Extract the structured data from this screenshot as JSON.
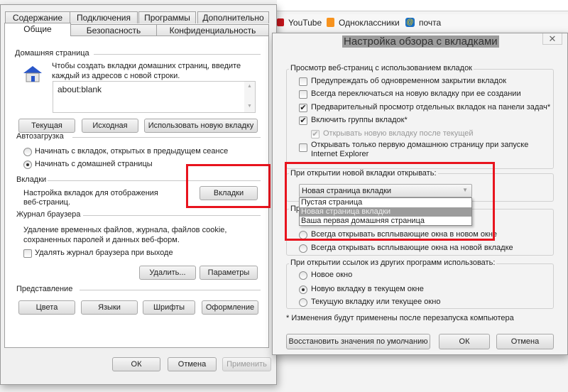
{
  "browser": {
    "favorites": [
      {
        "label": "YouTube",
        "icon": "youtube-icon",
        "color": "#c4161c"
      },
      {
        "label": "Одноклассники",
        "icon": "odnoklassniki-icon",
        "color": "#f7931e"
      },
      {
        "label": "почта",
        "icon": "mail-icon",
        "color": "#1a6fc4"
      }
    ]
  },
  "options": {
    "tabs_row1": [
      "Содержание",
      "Подключения",
      "Программы",
      "Дополнительно"
    ],
    "tabs_row2": [
      "Общие",
      "Безопасность",
      "Конфиденциальность"
    ],
    "active_tab": "Общие",
    "home": {
      "title": "Домашняя страница",
      "desc1": "Чтобы создать вкладки домашних страниц, введите",
      "desc2": "каждый из адресов с новой строки.",
      "value": "about:blank",
      "buttons": [
        "Текущая",
        "Исходная",
        "Использовать новую вкладку"
      ]
    },
    "startup": {
      "title": "Автозагрузка",
      "options": [
        "Начинать с вкладок, открытых в предыдущем сеансе",
        "Начинать с домашней страницы"
      ],
      "selected": 1
    },
    "tabs": {
      "title": "Вкладки",
      "desc1": "Настройка вкладок для отображения",
      "desc2": "веб-страниц.",
      "button": "Вкладки"
    },
    "history": {
      "title": "Журнал браузера",
      "desc1": "Удаление временных файлов, журнала, файлов cookie,",
      "desc2": "сохраненных паролей и данных веб-форм.",
      "checkbox": "Удалять журнал браузера при выходе",
      "checked": false,
      "buttons": [
        "Удалить...",
        "Параметры"
      ]
    },
    "appearance": {
      "title": "Представление",
      "buttons": [
        "Цвета",
        "Языки",
        "Шрифты",
        "Оформление"
      ]
    },
    "footer": {
      "ok": "ОК",
      "cancel": "Отмена",
      "apply": "Применить"
    }
  },
  "tabsettings": {
    "title": "Настройка обзора с вкладками",
    "browsing": {
      "title": "Просмотр веб-страниц с использованием вкладок",
      "items": [
        {
          "label": "Предупреждать об одновременном закрытии вкладок",
          "checked": false
        },
        {
          "label": "Всегда переключаться на новую вкладку при ее создании",
          "checked": false
        },
        {
          "label": "Предварительный просмотр отдельных вкладок на панели задач*",
          "checked": true
        },
        {
          "label": "Включить группы вкладок*",
          "checked": true
        },
        {
          "label": "Открывать новую вкладку после текущей",
          "checked": true,
          "disabled": true
        },
        {
          "label": "Открывать только первую домашнюю страницу при запуске",
          "label2": "Internet Explorer",
          "checked": false
        }
      ]
    },
    "newtab": {
      "title": "При открытии новой вкладки открывать:",
      "selected": "Новая страница вкладки",
      "options": [
        "Пустая страница",
        "Новая страница вкладки",
        "Ваша первая домашняя страница"
      ]
    },
    "popups": {
      "title_partial": "Пр",
      "options": [
        "Всегда открывать всплывающие окна в новом окне",
        "Всегда открывать всплывающие окна на новой вкладке"
      ]
    },
    "links": {
      "title": "При открытии ссылок из других программ использовать:",
      "options": [
        "Новое окно",
        "Новую вкладку в текущем окне",
        "Текущую вкладку или текущее окно"
      ],
      "selected": 1
    },
    "note": "* Изменения будут применены после перезапуска компьютера",
    "buttons": {
      "restore": "Восстановить значения по умолчанию",
      "ok": "ОК",
      "cancel": "Отмена"
    }
  },
  "highlight_color": "#e8141e"
}
